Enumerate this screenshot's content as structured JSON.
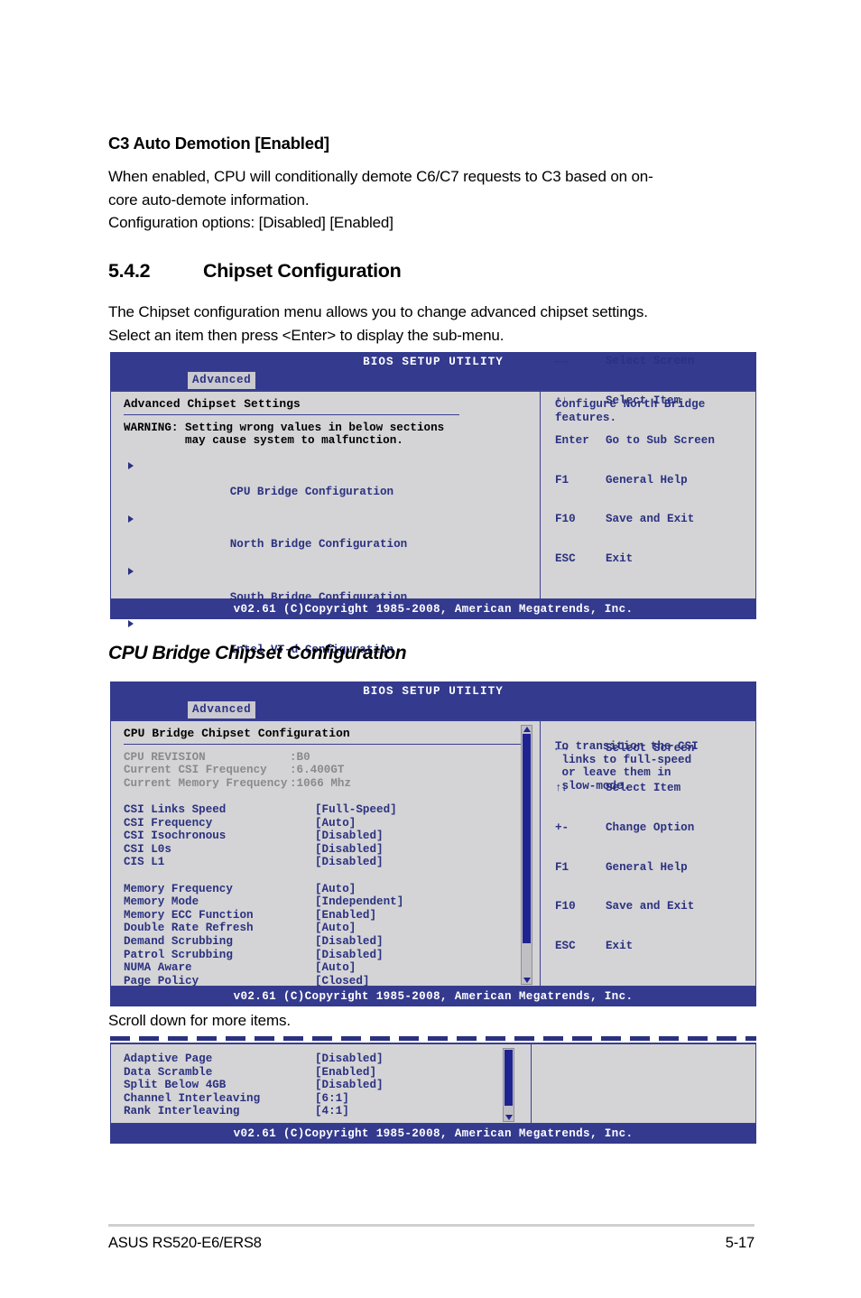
{
  "document": {
    "section_c3": {
      "heading": "C3 Auto Demotion [Enabled]",
      "para_line1": "When enabled, CPU will conditionally demote C6/C7 requests to C3 based on on-",
      "para_line2": "core auto-demote information.",
      "para_line3": "Configuration options: [Disabled] [Enabled]"
    },
    "section_542": {
      "number": "5.4.2",
      "title": "Chipset Configuration",
      "para_line1": "The Chipset configuration menu allows you to change advanced chipset settings.",
      "para_line2": "Select an item then press <Enter> to display the sub-menu."
    },
    "cpu_bridge_caption": "CPU Bridge Chipset Configuration",
    "scroll_note": "Scroll down for more items.",
    "footer": {
      "product": "ASUS RS520-E6/ERS8",
      "page": "5-17"
    }
  },
  "bios_common": {
    "title": "BIOS SETUP UTILITY",
    "tab": "Advanced",
    "copyright": "v02.61 (C)Copyright 1985-2008, American Megatrends, Inc."
  },
  "screen1": {
    "panel_title": "Advanced Chipset Settings",
    "warning_line1": "WARNING: Setting wrong values in below sections",
    "warning_line2": "         may cause system to malfunction.",
    "menu_items": [
      {
        "label": "CPU Bridge Configuration"
      },
      {
        "label": "North Bridge Configuration"
      },
      {
        "label": "South Bridge Configuration"
      },
      {
        "label": "Intel VT-d Configuration"
      }
    ],
    "help_line1": "Configure North Bridge",
    "help_line2": "features.",
    "navkeys": [
      {
        "key": "←→",
        "desc": "Select Screen"
      },
      {
        "key": "↑↓",
        "desc": "Select Item"
      },
      {
        "key": "Enter",
        "desc": "Go to Sub Screen"
      },
      {
        "key": "F1",
        "desc": "General Help"
      },
      {
        "key": "F10",
        "desc": "Save and Exit"
      },
      {
        "key": "ESC",
        "desc": "Exit"
      }
    ]
  },
  "screen2": {
    "panel_title": "CPU Bridge Chipset Configuration",
    "info_rows": [
      {
        "label": "CPU REVISION",
        "value": ":B0"
      },
      {
        "label": "Current CSI Frequency",
        "value": ":6.400GT"
      },
      {
        "label": "Current Memory Frequency",
        "value": ":1066 Mhz"
      }
    ],
    "csi_rows": [
      {
        "label": "CSI Links Speed",
        "value": "[Full-Speed]"
      },
      {
        "label": "CSI Frequency",
        "value": "[Auto]"
      },
      {
        "label": "CSI Isochronous",
        "value": "[Disabled]"
      },
      {
        "label": "CSI L0s",
        "value": "[Disabled]"
      },
      {
        "label": "CIS L1",
        "value": "[Disabled]"
      }
    ],
    "memory_rows": [
      {
        "label": "Memory Frequency",
        "value": "[Auto]"
      },
      {
        "label": "Memory Mode",
        "value": "[Independent]"
      },
      {
        "label": "Memory ECC Function",
        "value": "[Enabled]"
      },
      {
        "label": "Double Rate Refresh",
        "value": "[Auto]"
      },
      {
        "label": "Demand Scrubbing",
        "value": "[Disabled]"
      },
      {
        "label": "Patrol Scrubbing",
        "value": "[Disabled]"
      },
      {
        "label": "NUMA Aware",
        "value": "[Auto]"
      },
      {
        "label": "Page Policy",
        "value": "[Closed]"
      }
    ],
    "help_line1": "To transition the CSI",
    "help_line2": " links to full-speed",
    "help_line3": " or leave them in",
    "help_line4": " slow-mode.",
    "navkeys": [
      {
        "key": "←→",
        "desc": "Select Screen"
      },
      {
        "key": "↑↓",
        "desc": "Select Item"
      },
      {
        "key": "+-",
        "desc": "Change Option"
      },
      {
        "key": "F1",
        "desc": "General Help"
      },
      {
        "key": "F10",
        "desc": "Save and Exit"
      },
      {
        "key": "ESC",
        "desc": "Exit"
      }
    ]
  },
  "screen3": {
    "rows": [
      {
        "label": "Adaptive Page",
        "value": "[Disabled]"
      },
      {
        "label": "Data Scramble",
        "value": "[Enabled]"
      },
      {
        "label": "Split Below 4GB",
        "value": "[Disabled]"
      },
      {
        "label": "Channel Interleaving",
        "value": "[6:1]"
      },
      {
        "label": "Rank Interleaving",
        "value": "[4:1]"
      }
    ]
  },
  "colors": {
    "header_blue": "#343a8e",
    "text_blue": "#2b3180",
    "panel_gray": "#d4d4d6",
    "tab_gray": "#c9c9cf",
    "dim_gray": "#8a8a8e"
  }
}
